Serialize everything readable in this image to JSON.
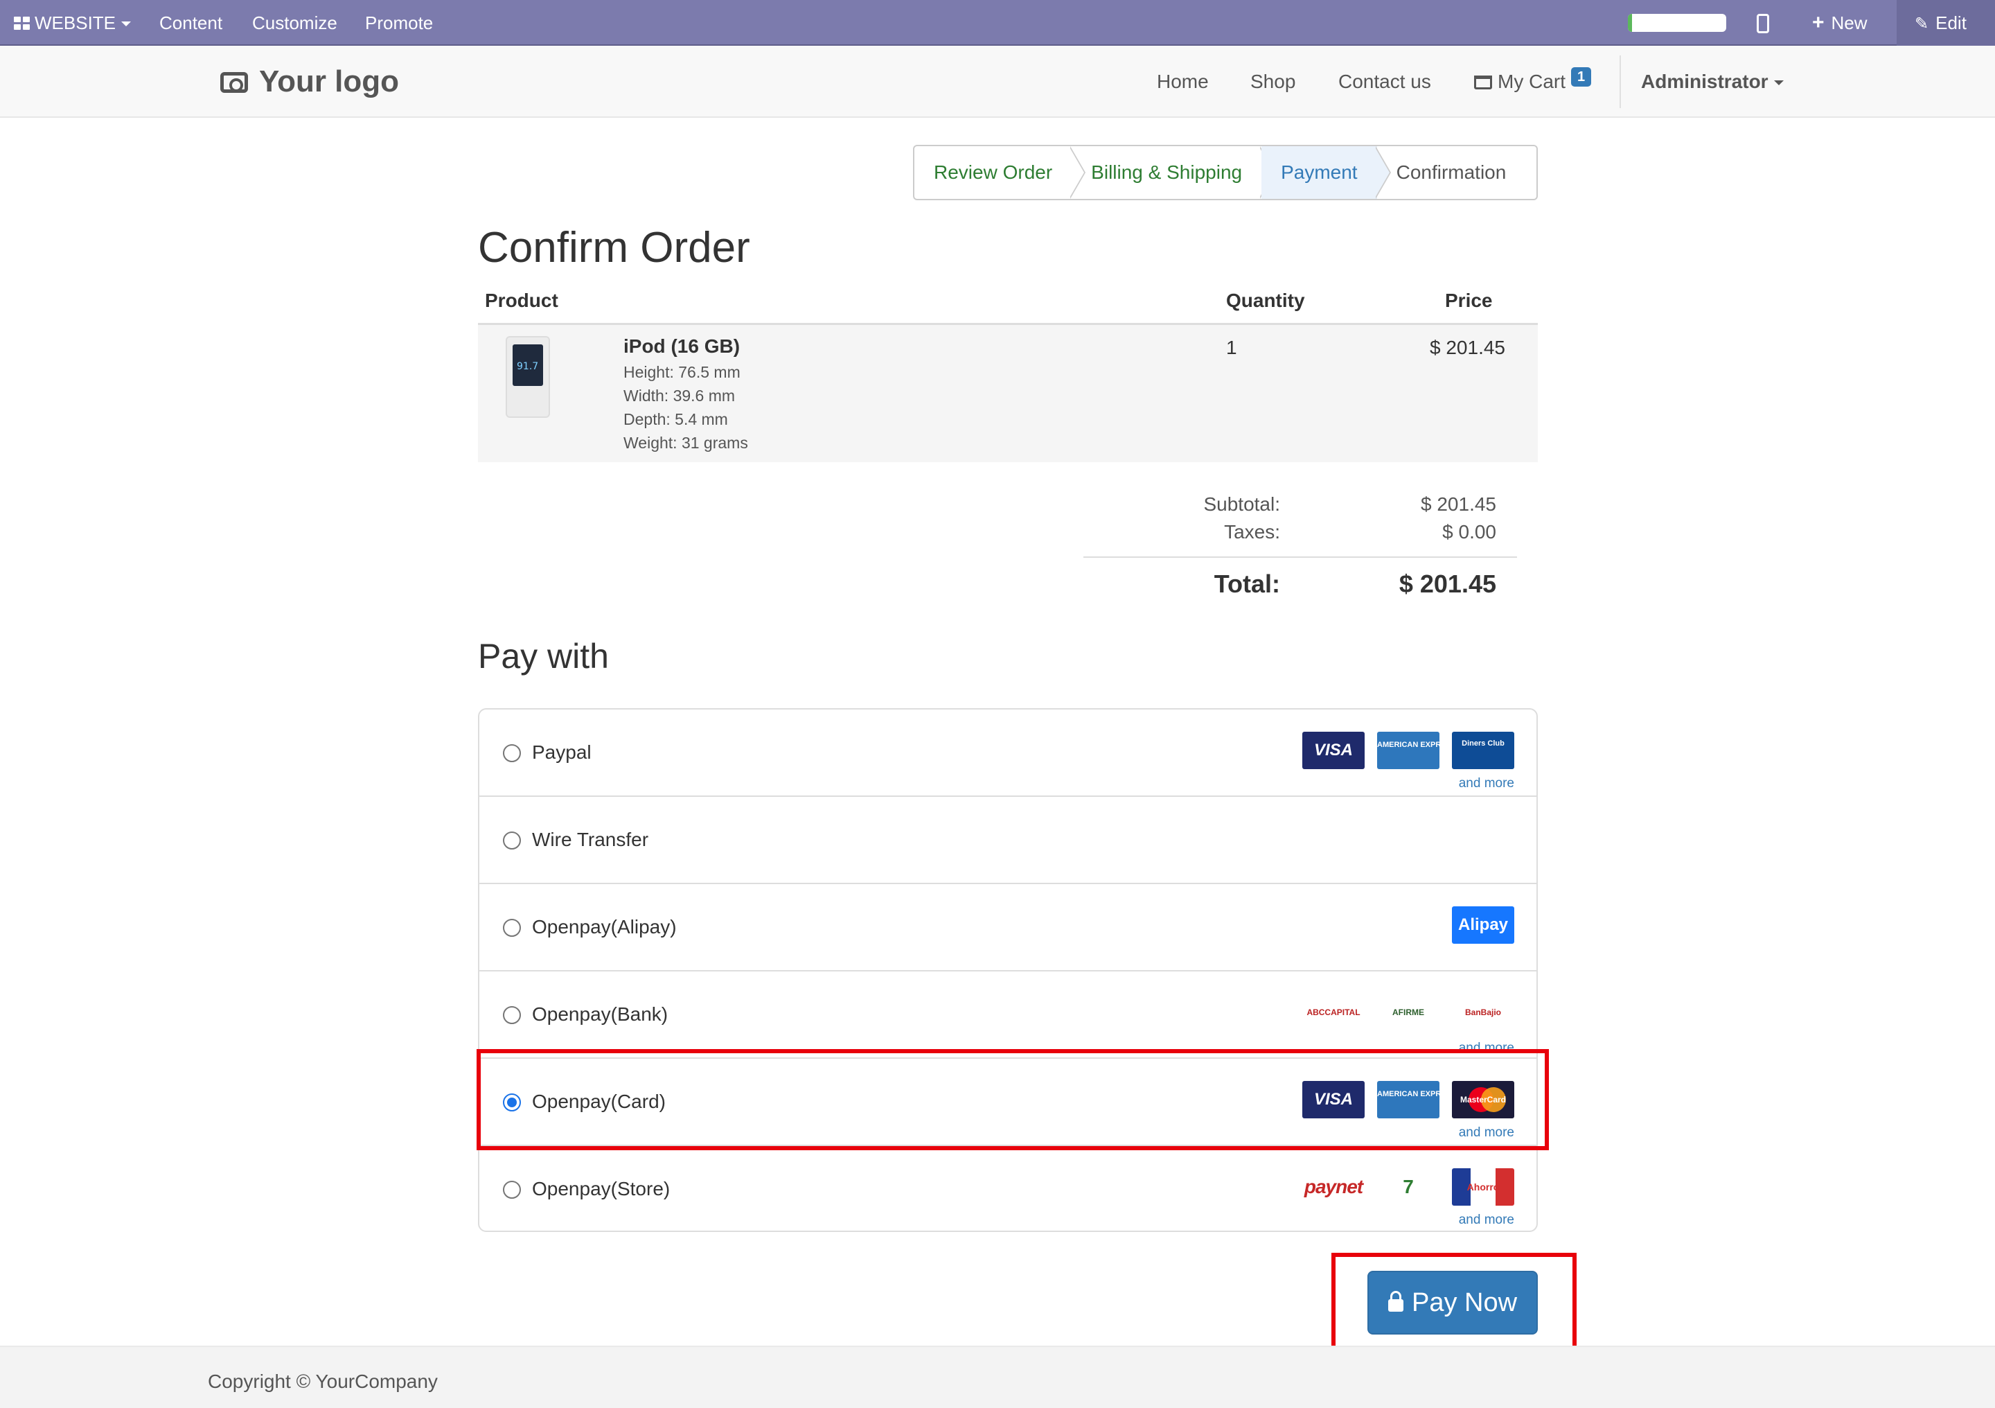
{
  "admin_bar": {
    "website_label": "WEBSITE",
    "content_label": "Content",
    "customize_label": "Customize",
    "promote_label": "Promote",
    "new_label": "New",
    "edit_label": "Edit",
    "progress_fraction": 0.04
  },
  "header": {
    "logo_text": "Your logo",
    "nav": {
      "home": "Home",
      "shop": "Shop",
      "contact": "Contact us",
      "cart": "My Cart",
      "cart_count": "1",
      "user": "Administrator"
    }
  },
  "wizard": {
    "steps": [
      "Review Order",
      "Billing & Shipping",
      "Payment",
      "Confirmation"
    ],
    "active_step": "Payment"
  },
  "order": {
    "title": "Confirm Order",
    "columns": {
      "product": "Product",
      "quantity": "Quantity",
      "price": "Price"
    },
    "lines": [
      {
        "image_text": "91.7",
        "name": "iPod (16 GB)",
        "attributes": [
          "Height: 76.5 mm",
          "Width: 39.6 mm",
          "Depth: 5.4 mm",
          "Weight: 31 grams"
        ],
        "quantity": "1",
        "price": "$ 201.45"
      }
    ],
    "summary": {
      "subtotal_label": "Subtotal:",
      "subtotal": "$ 201.45",
      "taxes_label": "Taxes:",
      "taxes": "$ 0.00",
      "total_label": "Total:",
      "total": "$ 201.45"
    }
  },
  "payment": {
    "heading": "Pay with",
    "and_more": "and more",
    "methods": [
      {
        "label": "Paypal",
        "selected": false,
        "logos": [
          "VISA",
          "AMERICAN EXPRESS",
          "Diners Club"
        ]
      },
      {
        "label": "Wire Transfer",
        "selected": false,
        "logos": []
      },
      {
        "label": "Openpay(Alipay)",
        "selected": false,
        "logos": [
          "Alipay"
        ]
      },
      {
        "label": "Openpay(Bank)",
        "selected": false,
        "logos": [
          "ABCCAPITAL",
          "AFIRME",
          "BanBajio"
        ]
      },
      {
        "label": "Openpay(Card)",
        "selected": true,
        "logos": [
          "VISA",
          "AMERICAN EXPRESS",
          "MasterCard"
        ]
      },
      {
        "label": "Openpay(Store)",
        "selected": false,
        "logos": [
          "paynet",
          "7",
          "Ahorro"
        ]
      }
    ],
    "pay_button": "Pay Now"
  },
  "footer": {
    "copyright": "Copyright © YourCompany"
  },
  "colors": {
    "admin_bar": "#7c7bad",
    "primary": "#337ab7",
    "highlight": "#e8000b",
    "step_done": "#2e7d32"
  }
}
